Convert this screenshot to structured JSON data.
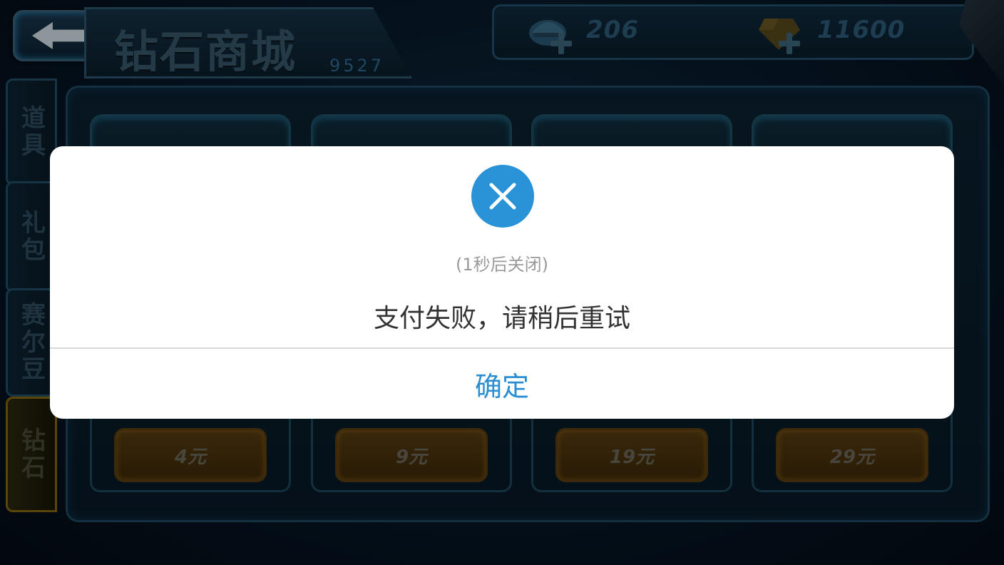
{
  "header": {
    "title": "钻石商城",
    "sub_number": "9527"
  },
  "currencies": [
    {
      "icon": "helmet-icon",
      "value": "206"
    },
    {
      "icon": "diamond-icon",
      "value": "11600"
    }
  ],
  "side_tabs": [
    {
      "label": "道具",
      "active": false
    },
    {
      "label": "礼包",
      "active": false
    },
    {
      "label": "赛尔豆",
      "active": false
    },
    {
      "label": "钻石",
      "active": true
    }
  ],
  "products": [
    {
      "price": "4元"
    },
    {
      "price": "9元"
    },
    {
      "price": "19元"
    },
    {
      "price": "29元"
    }
  ],
  "dialog": {
    "icon": "close-circle-icon",
    "countdown": "(1秒后关闭)",
    "message": "支付失败，请稍后重试",
    "confirm_label": "确定"
  },
  "colors": {
    "dialog_accent": "#2a93d8",
    "confirm_text": "#2a8ed0"
  }
}
